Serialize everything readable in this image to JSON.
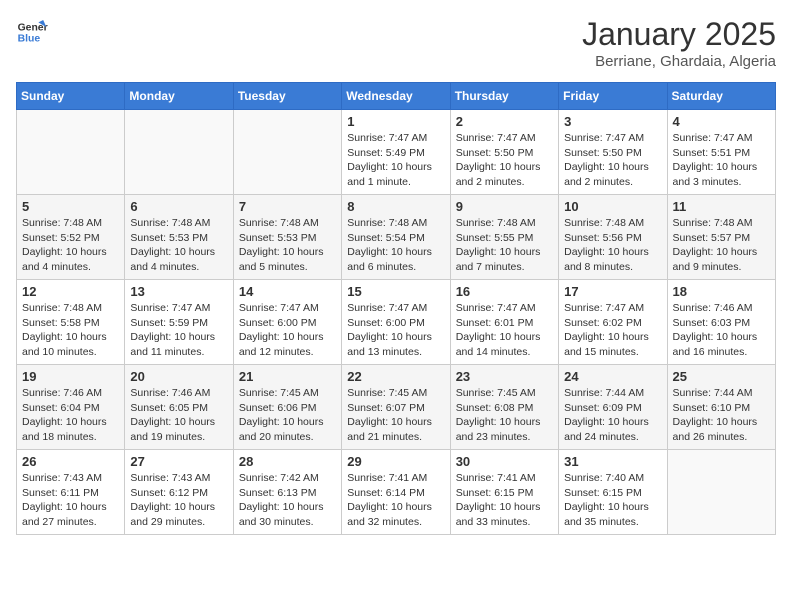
{
  "logo": {
    "line1": "General",
    "line2": "Blue"
  },
  "title": "January 2025",
  "subtitle": "Berriane, Ghardaia, Algeria",
  "days_of_week": [
    "Sunday",
    "Monday",
    "Tuesday",
    "Wednesday",
    "Thursday",
    "Friday",
    "Saturday"
  ],
  "weeks": [
    [
      {
        "day": "",
        "info": ""
      },
      {
        "day": "",
        "info": ""
      },
      {
        "day": "",
        "info": ""
      },
      {
        "day": "1",
        "info": "Sunrise: 7:47 AM\nSunset: 5:49 PM\nDaylight: 10 hours\nand 1 minute."
      },
      {
        "day": "2",
        "info": "Sunrise: 7:47 AM\nSunset: 5:50 PM\nDaylight: 10 hours\nand 2 minutes."
      },
      {
        "day": "3",
        "info": "Sunrise: 7:47 AM\nSunset: 5:50 PM\nDaylight: 10 hours\nand 2 minutes."
      },
      {
        "day": "4",
        "info": "Sunrise: 7:47 AM\nSunset: 5:51 PM\nDaylight: 10 hours\nand 3 minutes."
      }
    ],
    [
      {
        "day": "5",
        "info": "Sunrise: 7:48 AM\nSunset: 5:52 PM\nDaylight: 10 hours\nand 4 minutes."
      },
      {
        "day": "6",
        "info": "Sunrise: 7:48 AM\nSunset: 5:53 PM\nDaylight: 10 hours\nand 4 minutes."
      },
      {
        "day": "7",
        "info": "Sunrise: 7:48 AM\nSunset: 5:53 PM\nDaylight: 10 hours\nand 5 minutes."
      },
      {
        "day": "8",
        "info": "Sunrise: 7:48 AM\nSunset: 5:54 PM\nDaylight: 10 hours\nand 6 minutes."
      },
      {
        "day": "9",
        "info": "Sunrise: 7:48 AM\nSunset: 5:55 PM\nDaylight: 10 hours\nand 7 minutes."
      },
      {
        "day": "10",
        "info": "Sunrise: 7:48 AM\nSunset: 5:56 PM\nDaylight: 10 hours\nand 8 minutes."
      },
      {
        "day": "11",
        "info": "Sunrise: 7:48 AM\nSunset: 5:57 PM\nDaylight: 10 hours\nand 9 minutes."
      }
    ],
    [
      {
        "day": "12",
        "info": "Sunrise: 7:48 AM\nSunset: 5:58 PM\nDaylight: 10 hours\nand 10 minutes."
      },
      {
        "day": "13",
        "info": "Sunrise: 7:47 AM\nSunset: 5:59 PM\nDaylight: 10 hours\nand 11 minutes."
      },
      {
        "day": "14",
        "info": "Sunrise: 7:47 AM\nSunset: 6:00 PM\nDaylight: 10 hours\nand 12 minutes."
      },
      {
        "day": "15",
        "info": "Sunrise: 7:47 AM\nSunset: 6:00 PM\nDaylight: 10 hours\nand 13 minutes."
      },
      {
        "day": "16",
        "info": "Sunrise: 7:47 AM\nSunset: 6:01 PM\nDaylight: 10 hours\nand 14 minutes."
      },
      {
        "day": "17",
        "info": "Sunrise: 7:47 AM\nSunset: 6:02 PM\nDaylight: 10 hours\nand 15 minutes."
      },
      {
        "day": "18",
        "info": "Sunrise: 7:46 AM\nSunset: 6:03 PM\nDaylight: 10 hours\nand 16 minutes."
      }
    ],
    [
      {
        "day": "19",
        "info": "Sunrise: 7:46 AM\nSunset: 6:04 PM\nDaylight: 10 hours\nand 18 minutes."
      },
      {
        "day": "20",
        "info": "Sunrise: 7:46 AM\nSunset: 6:05 PM\nDaylight: 10 hours\nand 19 minutes."
      },
      {
        "day": "21",
        "info": "Sunrise: 7:45 AM\nSunset: 6:06 PM\nDaylight: 10 hours\nand 20 minutes."
      },
      {
        "day": "22",
        "info": "Sunrise: 7:45 AM\nSunset: 6:07 PM\nDaylight: 10 hours\nand 21 minutes."
      },
      {
        "day": "23",
        "info": "Sunrise: 7:45 AM\nSunset: 6:08 PM\nDaylight: 10 hours\nand 23 minutes."
      },
      {
        "day": "24",
        "info": "Sunrise: 7:44 AM\nSunset: 6:09 PM\nDaylight: 10 hours\nand 24 minutes."
      },
      {
        "day": "25",
        "info": "Sunrise: 7:44 AM\nSunset: 6:10 PM\nDaylight: 10 hours\nand 26 minutes."
      }
    ],
    [
      {
        "day": "26",
        "info": "Sunrise: 7:43 AM\nSunset: 6:11 PM\nDaylight: 10 hours\nand 27 minutes."
      },
      {
        "day": "27",
        "info": "Sunrise: 7:43 AM\nSunset: 6:12 PM\nDaylight: 10 hours\nand 29 minutes."
      },
      {
        "day": "28",
        "info": "Sunrise: 7:42 AM\nSunset: 6:13 PM\nDaylight: 10 hours\nand 30 minutes."
      },
      {
        "day": "29",
        "info": "Sunrise: 7:41 AM\nSunset: 6:14 PM\nDaylight: 10 hours\nand 32 minutes."
      },
      {
        "day": "30",
        "info": "Sunrise: 7:41 AM\nSunset: 6:15 PM\nDaylight: 10 hours\nand 33 minutes."
      },
      {
        "day": "31",
        "info": "Sunrise: 7:40 AM\nSunset: 6:15 PM\nDaylight: 10 hours\nand 35 minutes."
      },
      {
        "day": "",
        "info": ""
      }
    ]
  ]
}
